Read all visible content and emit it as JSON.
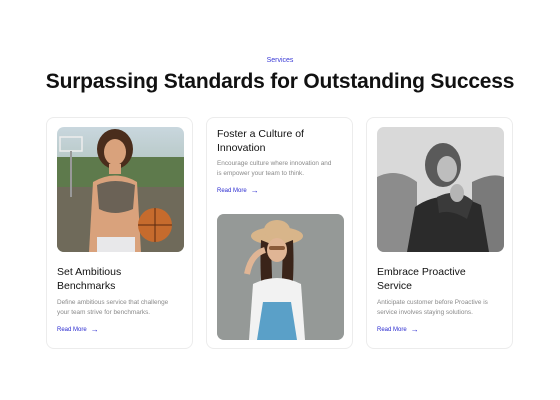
{
  "section": {
    "eyebrow": "Services",
    "title": "Surpassing Standards for Outstanding Success"
  },
  "cards": [
    {
      "title_line1": "Set Ambitious",
      "title_line2": "Benchmarks",
      "desc_line1": "Define ambitious service that challenge",
      "desc_line2": "your team strive for benchmarks.",
      "link": "Read More",
      "image": "woman-with-basketball-photo"
    },
    {
      "title_line1": "Foster a Culture of",
      "title_line2": "Innovation",
      "desc_line1": "Encourage culture where innovation and",
      "desc_line2": "is empower your team to think.",
      "link": "Read More",
      "image": "woman-in-straw-hat-photo"
    },
    {
      "title_line1": "Embrace Proactive",
      "title_line2": "Service",
      "desc_line1": "Anticipate customer before Proactive is",
      "desc_line2": "service involves staying solutions.",
      "link": "Read More",
      "image": "woman-black-and-white-photo"
    }
  ],
  "colors": {
    "accent": "#3b3bd6",
    "heading": "#111111",
    "muted": "#8a8a8a",
    "card_border": "#ececec"
  }
}
